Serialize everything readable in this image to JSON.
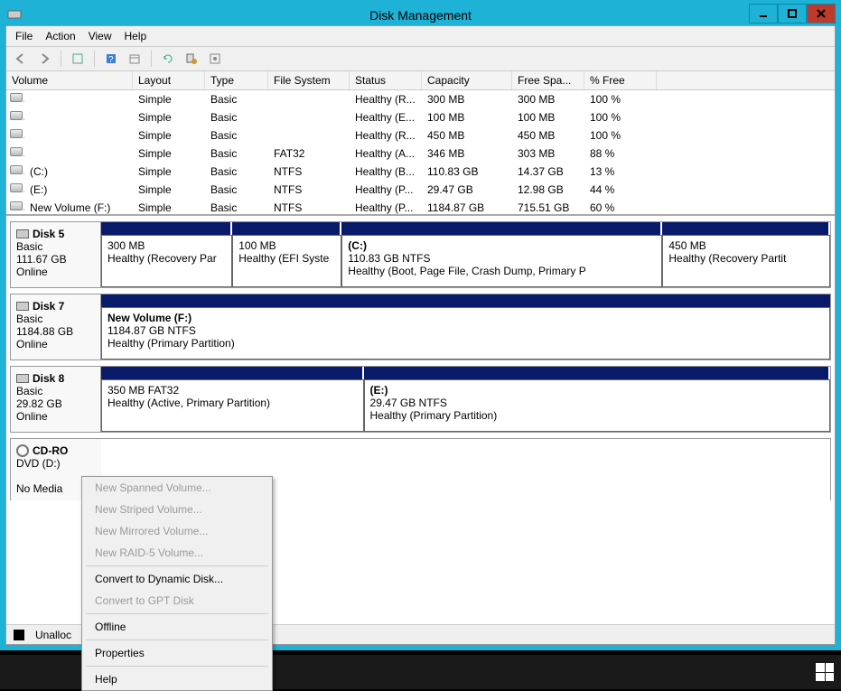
{
  "window": {
    "title": "Disk Management"
  },
  "menu": {
    "file": "File",
    "action": "Action",
    "view": "View",
    "help": "Help"
  },
  "columns": {
    "volume": "Volume",
    "layout": "Layout",
    "type": "Type",
    "fs": "File System",
    "status": "Status",
    "capacity": "Capacity",
    "free": "Free Spa...",
    "pct": "% Free"
  },
  "volumes": [
    {
      "name": "",
      "layout": "Simple",
      "type": "Basic",
      "fs": "",
      "status": "Healthy (R...",
      "capacity": "300 MB",
      "free": "300 MB",
      "pct": "100 %"
    },
    {
      "name": "",
      "layout": "Simple",
      "type": "Basic",
      "fs": "",
      "status": "Healthy (E...",
      "capacity": "100 MB",
      "free": "100 MB",
      "pct": "100 %"
    },
    {
      "name": "",
      "layout": "Simple",
      "type": "Basic",
      "fs": "",
      "status": "Healthy (R...",
      "capacity": "450 MB",
      "free": "450 MB",
      "pct": "100 %"
    },
    {
      "name": "",
      "layout": "Simple",
      "type": "Basic",
      "fs": "FAT32",
      "status": "Healthy (A...",
      "capacity": "346 MB",
      "free": "303 MB",
      "pct": "88 %"
    },
    {
      "name": "(C:)",
      "layout": "Simple",
      "type": "Basic",
      "fs": "NTFS",
      "status": "Healthy (B...",
      "capacity": "110.83 GB",
      "free": "14.37 GB",
      "pct": "13 %"
    },
    {
      "name": "(E:)",
      "layout": "Simple",
      "type": "Basic",
      "fs": "NTFS",
      "status": "Healthy (P...",
      "capacity": "29.47 GB",
      "free": "12.98 GB",
      "pct": "44 %"
    },
    {
      "name": "New Volume (F:)",
      "layout": "Simple",
      "type": "Basic",
      "fs": "NTFS",
      "status": "Healthy (P...",
      "capacity": "1184.87 GB",
      "free": "715.51 GB",
      "pct": "60 %"
    }
  ],
  "disks": {
    "d5": {
      "name": "Disk 5",
      "type": "Basic",
      "size": "111.67 GB",
      "state": "Online",
      "parts": [
        {
          "ln1": "300 MB",
          "ln2": "Healthy (Recovery Par"
        },
        {
          "ln1": "100 MB",
          "ln2": "Healthy (EFI Syste"
        },
        {
          "title": "(C:)",
          "ln1": "110.83 GB NTFS",
          "ln2": "Healthy (Boot, Page File, Crash Dump, Primary P"
        },
        {
          "ln1": "450 MB",
          "ln2": "Healthy (Recovery Partit"
        }
      ]
    },
    "d7": {
      "name": "Disk 7",
      "type": "Basic",
      "size": "1184.88 GB",
      "state": "Online",
      "parts": [
        {
          "title": "New Volume  (F:)",
          "ln1": "1184.87 GB NTFS",
          "ln2": "Healthy (Primary Partition)"
        }
      ]
    },
    "d8": {
      "name": "Disk 8",
      "type": "Basic",
      "size": "29.82 GB",
      "state": "Online",
      "parts": [
        {
          "ln1": "350 MB FAT32",
          "ln2": "Healthy (Active, Primary Partition)"
        },
        {
          "title": "(E:)",
          "ln1": "29.47 GB NTFS",
          "ln2": "Healthy (Primary Partition)"
        }
      ]
    },
    "cd": {
      "name": "CD-RO",
      "type": "DVD (D:)",
      "state": "No Media"
    }
  },
  "legend": {
    "unalloc": "Unalloc"
  },
  "context": {
    "spanned": "New Spanned Volume...",
    "striped": "New Striped Volume...",
    "mirrored": "New Mirrored Volume...",
    "raid5": "New RAID-5 Volume...",
    "dynamic": "Convert to Dynamic Disk...",
    "gpt": "Convert to GPT Disk",
    "offline": "Offline",
    "properties": "Properties",
    "help": "Help"
  }
}
